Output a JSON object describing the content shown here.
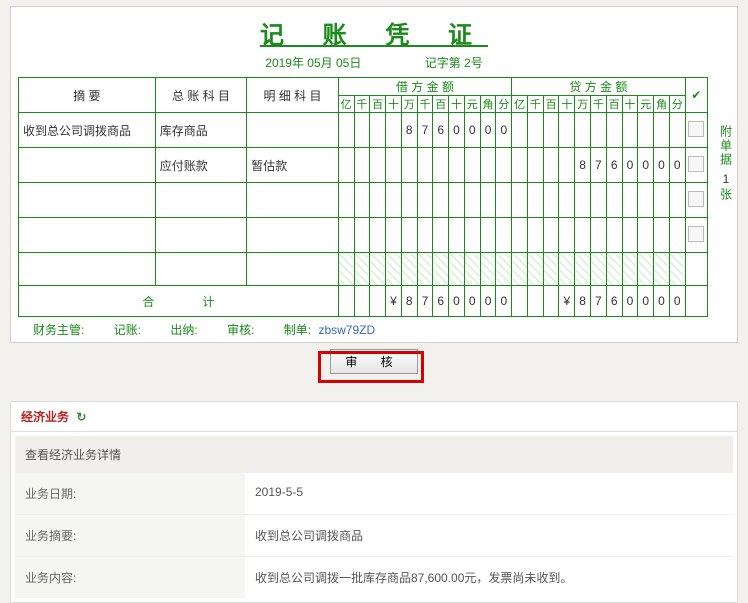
{
  "voucher": {
    "title": "记 账 凭 证",
    "date_text": "2019年 05月 05日",
    "number_label": "记字第 2号",
    "headers": {
      "abstract": "摘 要",
      "general_account": "总 账 科 目",
      "sub_account": "明 细 科 目",
      "debit": "借 方 金 额",
      "credit": "贷 方 金 额",
      "digits": [
        "亿",
        "千",
        "百",
        "十",
        "万",
        "千",
        "百",
        "十",
        "元",
        "角",
        "分"
      ]
    },
    "rows": [
      {
        "abstract": "收到总公司调拨商品",
        "account": "库存商品",
        "sub": "",
        "debit": [
          "",
          "",
          "",
          "",
          "8",
          "7",
          "6",
          "0",
          "0",
          "0",
          "0"
        ],
        "credit": [
          "",
          "",
          "",
          "",
          "",
          "",
          "",
          "",
          "",
          "",
          ""
        ]
      },
      {
        "abstract": "",
        "account": "应付账款",
        "sub": "暂估款",
        "debit": [
          "",
          "",
          "",
          "",
          "",
          "",
          "",
          "",
          "",
          "",
          ""
        ],
        "credit": [
          "",
          "",
          "",
          "",
          "8",
          "7",
          "6",
          "0",
          "0",
          "0",
          "0"
        ]
      },
      {
        "abstract": "",
        "account": "",
        "sub": "",
        "debit": [
          "",
          "",
          "",
          "",
          "",
          "",
          "",
          "",
          "",
          "",
          ""
        ],
        "credit": [
          "",
          "",
          "",
          "",
          "",
          "",
          "",
          "",
          "",
          "",
          ""
        ]
      },
      {
        "abstract": "",
        "account": "",
        "sub": "",
        "debit": [
          "",
          "",
          "",
          "",
          "",
          "",
          "",
          "",
          "",
          "",
          ""
        ],
        "credit": [
          "",
          "",
          "",
          "",
          "",
          "",
          "",
          "",
          "",
          "",
          ""
        ]
      }
    ],
    "total": {
      "label": "合　　　　计",
      "debit": [
        "",
        "",
        "",
        "¥",
        "8",
        "7",
        "6",
        "0",
        "0",
        "0",
        "0"
      ],
      "credit": [
        "",
        "",
        "",
        "¥",
        "8",
        "7",
        "6",
        "0",
        "0",
        "0",
        "0"
      ]
    },
    "attachment_label": "附单据",
    "attachment_count": "1",
    "attachment_unit": "张",
    "signatures": {
      "fin_mgr": "财务主管:",
      "bookkeeper": "记账:",
      "cashier": "出纳:",
      "auditor": "审核:",
      "maker_label": "制单:",
      "maker_value": "zbsw79ZD"
    },
    "audit_button": "审 核"
  },
  "biz_section": {
    "title": "经济业务",
    "panel_title": "查看经济业务详情",
    "rows": {
      "date_label": "业务日期:",
      "date_value": "2019-5-5",
      "summary_label": "业务摘要:",
      "summary_value": "收到总公司调拨商品",
      "content_label": "业务内容:",
      "content_value": "收到总公司调拨一批库存商品87,600.00元，发票尚未收到。"
    }
  }
}
